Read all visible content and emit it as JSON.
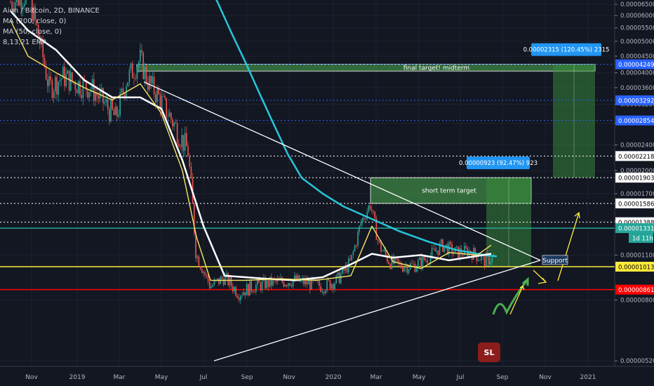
{
  "legend": {
    "symbol": "Aion / Bitcoin, 2D, BINANCE",
    "ma200": "MA (200, close, 0)",
    "ma50": "MA (50, close, 0)",
    "ema": "8,13,21 EMA"
  },
  "chart_data": {
    "type": "line",
    "title": "Aion / Bitcoin, 2D, BINANCE",
    "x_tick_labels": [
      "Nov",
      "2019",
      "Mar",
      "May",
      "Jul",
      "Sep",
      "Nov",
      "2020",
      "Mar",
      "May",
      "Jul",
      "Sep",
      "Nov",
      "2021"
    ],
    "y_tick_labels": [
      "0.00006500",
      "0.00006000",
      "0.00005500",
      "0.00005000",
      "0.00004500",
      "0.00004000",
      "0.00003600",
      "0.00003200",
      "0.00002800",
      "0.00002400",
      "0.00002000",
      "0.00001700",
      "0.00001400",
      "0.00001100",
      "0.00000800",
      "0.00000520"
    ],
    "y_axis_scale": "log",
    "price_levels": [
      {
        "label": "0.00004249",
        "value": 4.249e-05,
        "color": "#2962ff",
        "style": "dotted"
      },
      {
        "label": "0.00003292",
        "value": 3.292e-05,
        "color": "#2962ff",
        "style": "dotted"
      },
      {
        "label": "0.00002854",
        "value": 2.854e-05,
        "color": "#2962ff",
        "style": "dotted"
      },
      {
        "label": "0.00002218",
        "value": 2.218e-05,
        "color": "#ffffff",
        "style": "dotted"
      },
      {
        "label": "0.00001903",
        "value": 1.903e-05,
        "color": "#ffffff",
        "style": "dotted"
      },
      {
        "label": "0.00001586",
        "value": 1.586e-05,
        "color": "#ffffff",
        "style": "dotted"
      },
      {
        "label": "0.00001388",
        "value": 1.388e-05,
        "color": "#ffffff",
        "style": "dotted"
      },
      {
        "label": "0.00001331",
        "value": 1.331e-05,
        "color": "#26a69a",
        "style": "solid",
        "box_bg": "#26a69a",
        "sub_label": "1d 11h"
      },
      {
        "label": "0.00001013",
        "value": 1.013e-05,
        "color": "#ffeb3b",
        "style": "solid",
        "box_bg": "#ffeb3b",
        "box_fg": "#000000"
      },
      {
        "label": "0.00000861",
        "value": 8.61e-06,
        "color": "#ff0000",
        "style": "solid",
        "box_bg": "#ff0000"
      }
    ],
    "zones": [
      {
        "label": "final target! midterm",
        "from": 4.05e-05,
        "to": 4.249e-05
      },
      {
        "label": "short term target",
        "from": 1.586e-05,
        "to": 1.903e-05
      },
      {
        "label": "0.00000923 (92.47%) 923",
        "from": 1.013e-05,
        "to": 1.903e-05
      },
      {
        "label": "0.00002315 (120.45%) 2315",
        "from": 1.903e-05,
        "to": 4.249e-05
      }
    ],
    "annotations": [
      "Support",
      "SL"
    ],
    "series": [
      {
        "name": "MA (200, close, 0)",
        "color": "#26c6da",
        "values": [
          8e-05,
          6.6e-05,
          5.3e-05,
          4.3e-05,
          3.45e-05,
          2.78e-05,
          2.25e-05,
          1.9e-05,
          1.7e-05,
          1.55e-05,
          1.42e-05,
          1.3e-05,
          1.21e-05,
          1.14e-05,
          1.1e-05,
          1.09e-05
        ]
      },
      {
        "name": "MA (50, close, 0)",
        "color": "#ffffff",
        "values": [
          6.2e-05,
          5.4e-05,
          4.7e-05,
          3.8e-05,
          3.36e-05,
          3.36e-05,
          3.1e-05,
          2.15e-05,
          1.35e-05,
          9.5e-06,
          9.4e-06,
          9.3e-06,
          9.2e-06,
          9.4e-06,
          1.03e-05,
          1.11e-05,
          1.08e-05,
          1.1e-05,
          1.06e-05,
          1.11e-05
        ]
      },
      {
        "name": "8,13,21 EMA",
        "color": "#f5e663",
        "values": [
          5.8e-05,
          4.5e-05,
          4e-05,
          3.6e-05,
          3.3e-05,
          3.7e-05,
          3e-05,
          2e-05,
          1.25e-05,
          9.2e-06,
          9.2e-06,
          9.3e-06,
          9.2e-06,
          9.5e-06,
          1.35e-05,
          1.05e-05,
          1e-05,
          1.12e-05,
          1.1e-05,
          1.18e-05
        ]
      }
    ]
  }
}
